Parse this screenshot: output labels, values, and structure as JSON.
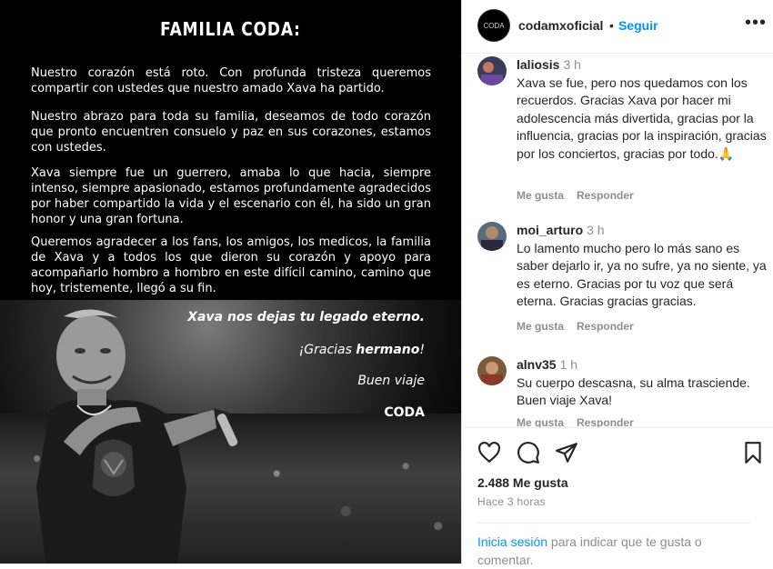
{
  "post": {
    "title": "FAMILIA CODA:",
    "paragraphs": [
      "Nuestro corazón está roto. Con profunda tristeza queremos compartir con ustedes que nuestro amado Xava ha partido.",
      "Nuestro abrazo para toda su familia, deseamos de todo corazón que pronto encuentren consuelo y paz en sus corazones, estamos con ustedes.",
      "Xava siempre fue un guerrero, amaba lo que hacia, siempre intenso, siempre apasionado, estamos profundamente agradecidos por haber compartido la vida y el escenario con él, ha sido un gran honor y una gran fortuna.",
      "Queremos agradecer a los fans, los amigos, los medicos, la familia de Xava y a todos los que dieron su corazón y apoyo para acompañarlo hombro a hombro en este difícil camino, camino que hoy, tristemente, llegó a su fin."
    ],
    "legacy": "Xava nos dejas tu legado eterno.",
    "thanks_prefix": "¡Gracias ",
    "thanks_bold": "hermano",
    "thanks_suffix": "!",
    "farewell": "Buen viaje",
    "signature": "CODA"
  },
  "header": {
    "avatar_text": "CODA",
    "username": "codamxoficial",
    "dot": "•",
    "follow": "Seguir",
    "more": "•••"
  },
  "comments": [
    {
      "user": "laliosis",
      "time": "3 h",
      "text": "Xava se fue, pero nos quedamos con los recuerdos. Gracias Xava por hacer mi adolescencia más divertida, gracias por la influencia, gracias por la inspiración, gracias por los conciertos, gracias por todo.🙏",
      "like": "Me gusta",
      "reply": "Responder"
    },
    {
      "user": "moi_arturo",
      "time": "3 h",
      "text": "Lo lamento mucho pero lo más sano es saber dejarlo ir, ya no sufre, ya no siente, ya es eterno. Gracias por tu voz que será eterna. Gracias gracias gracias.",
      "like": "Me gusta",
      "reply": "Responder"
    },
    {
      "user": "alnv35",
      "time": "1 h",
      "text": "Su cuerpo descasna, su alma trasciende. Buen viaje Xava!",
      "like": "Me gusta",
      "reply": "Responder"
    }
  ],
  "actions": {
    "likes": "2.488 Me gusta",
    "time_ago": "Hace 3 horas",
    "login_link": "Inicia sesión",
    "login_text": " para indicar que te gusta o comentar."
  },
  "colors": {
    "link": "#0095f6",
    "text": "#262626",
    "muted": "#8e8e8e"
  }
}
